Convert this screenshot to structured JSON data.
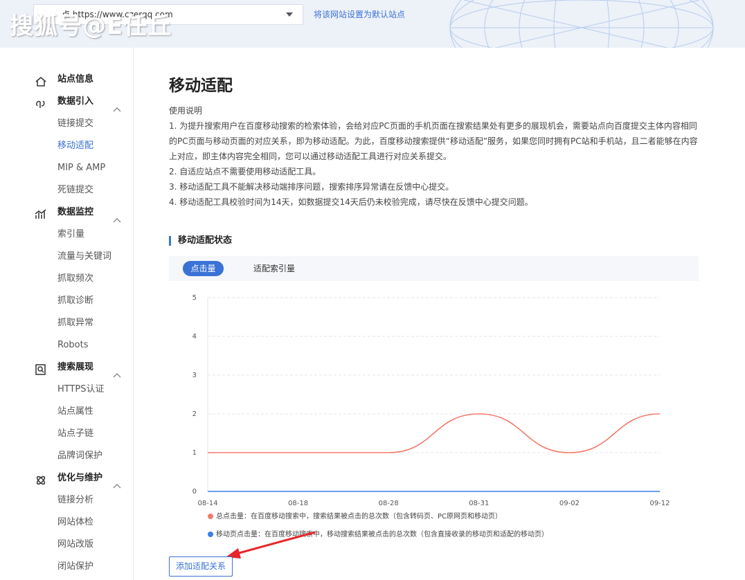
{
  "topbar": {
    "site_value": "点 https://www.czerqq.com",
    "default_link": "将该网站设置为默认站点",
    "watermark": "搜狐号@E任丘"
  },
  "sidebar": {
    "items": [
      {
        "type": "group",
        "label": "站点信息",
        "icon": "home-icon"
      },
      {
        "type": "group",
        "label": "数据引入",
        "icon": "data-import-icon",
        "expanded": true
      },
      {
        "type": "sub",
        "label": "链接提交"
      },
      {
        "type": "sub",
        "label": "移动适配",
        "active": true
      },
      {
        "type": "sub",
        "label": "MIP & AMP"
      },
      {
        "type": "sub",
        "label": "死链提交"
      },
      {
        "type": "group",
        "label": "数据监控",
        "icon": "chart-icon",
        "expanded": true
      },
      {
        "type": "sub",
        "label": "索引量"
      },
      {
        "type": "sub",
        "label": "流量与关键词"
      },
      {
        "type": "sub",
        "label": "抓取频次"
      },
      {
        "type": "sub",
        "label": "抓取诊断"
      },
      {
        "type": "sub",
        "label": "抓取异常"
      },
      {
        "type": "sub",
        "label": "Robots"
      },
      {
        "type": "group",
        "label": "搜索展现",
        "icon": "search-display-icon",
        "expanded": true
      },
      {
        "type": "sub",
        "label": "HTTPS认证"
      },
      {
        "type": "sub",
        "label": "站点属性"
      },
      {
        "type": "sub",
        "label": "站点子链"
      },
      {
        "type": "sub",
        "label": "品牌词保护"
      },
      {
        "type": "group",
        "label": "优化与维护",
        "icon": "optimize-icon",
        "expanded": true
      },
      {
        "type": "sub",
        "label": "链接分析"
      },
      {
        "type": "sub",
        "label": "网站体检"
      },
      {
        "type": "sub",
        "label": "网站改版"
      },
      {
        "type": "sub",
        "label": "闭站保护"
      }
    ]
  },
  "main": {
    "title": "移动适配",
    "desc_lines": [
      "使用说明",
      "1. 为提升搜索用户在百度移动搜索的检索体验，会给对应PC页面的手机页面在搜索结果处有更多的展现机会，需要站点向百度提交主体内容相同的PC页面与移动页面的对应关系，即为移动适配。为此，百度移动搜索提供“移动适配”服务，如果您同时拥有PC站和手机站，且二者能够在内容上对应，即主体内容完全相同，您可以通过移动适配工具进行对应关系提交。",
      "2. 自适应站点不需要使用移动适配工具。",
      "3. 移动适配工具不能解决移动端排序问题，搜索排序异常请在反馈中心提交。",
      "4. 移动适配工具校验时间为14天，如数据提交14天后仍未校验完成，请尽快在反馈中心提交问题。"
    ],
    "section_title": "移动适配状态",
    "tabs": [
      "点击量",
      "适配索引量"
    ],
    "add_button": "添加适配关系"
  },
  "colors": {
    "accent": "#3a72d6",
    "series_total": "#f47a6c",
    "series_mobile": "#3a7ee8"
  },
  "chart_data": {
    "type": "line",
    "x": [
      "08-14",
      "08-18",
      "08-28",
      "08-31",
      "09-02",
      "09-12"
    ],
    "ylim": [
      0,
      5
    ],
    "yticks": [
      0,
      1,
      2,
      3,
      4,
      5
    ],
    "series": [
      {
        "name": "总点击量：在百度移动搜索中，搜索结果被点击的总次数（包含转码页、PC原网页和移动页）",
        "values": [
          1,
          1,
          1,
          2,
          1,
          2
        ],
        "color": "#f47a6c"
      },
      {
        "name": "移动页点击量：在百度移动搜索中，移动搜索结果被点击的总次数（包含直接收录的移动页和适配的移动页）",
        "values": [
          0,
          0,
          0,
          0,
          0,
          0
        ],
        "color": "#3a7ee8"
      }
    ],
    "smooth": true,
    "grid": true,
    "legend": "bottom"
  }
}
